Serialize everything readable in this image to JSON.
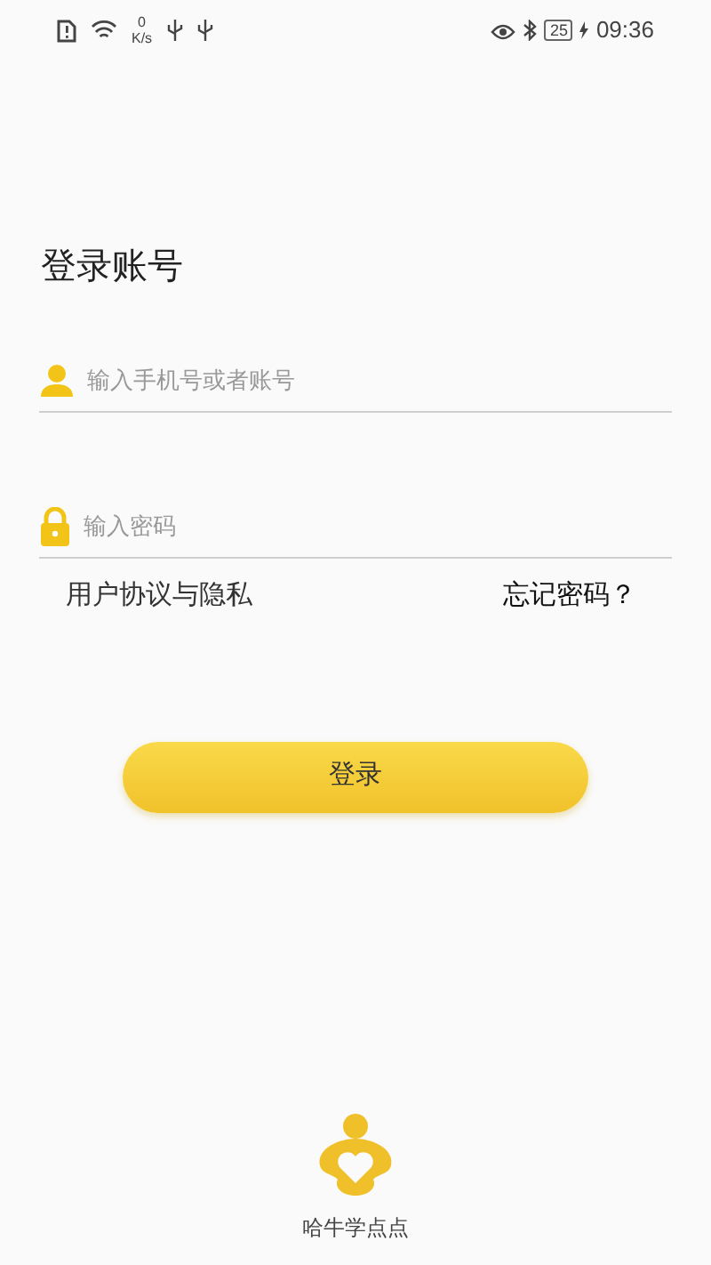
{
  "status_bar": {
    "speed_value": "0",
    "speed_unit": "K/s",
    "battery": "25",
    "time": "09:36"
  },
  "title": "登录账号",
  "fields": [
    {
      "kind": "account",
      "placeholder": "输入手机号或者账号"
    },
    {
      "kind": "password",
      "placeholder": "输入密码"
    }
  ],
  "links": {
    "agreement": "用户协议与隐私",
    "forgot": "忘记密码？"
  },
  "login_button": "登录",
  "app_name": "哈牛学点点"
}
